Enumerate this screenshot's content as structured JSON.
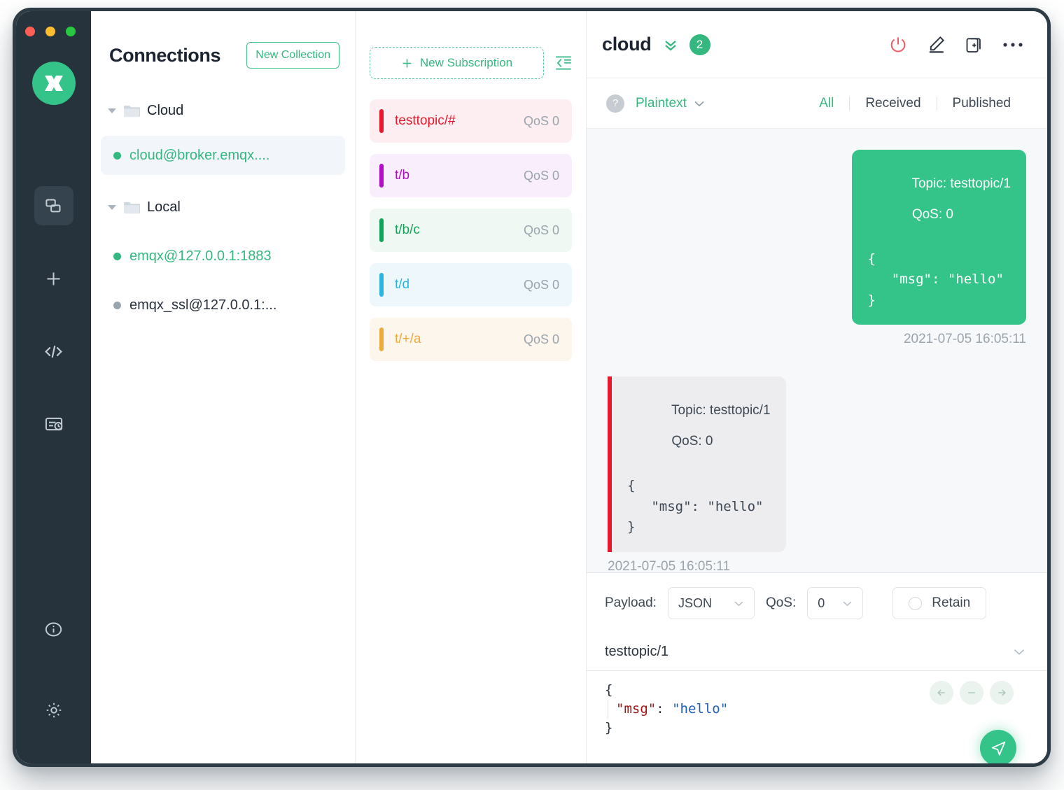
{
  "window": {
    "traffic_lights": [
      "close",
      "minimize",
      "maximize"
    ],
    "accent": "#34b87f",
    "logo_name": "mqttx-logo"
  },
  "rail": {
    "items": [
      {
        "icon": "connections-icon",
        "name": "rail-connections",
        "active": true
      },
      {
        "icon": "plus-icon",
        "name": "rail-new-connection",
        "active": false
      },
      {
        "icon": "code-icon",
        "name": "rail-script",
        "active": false
      },
      {
        "icon": "log-history-icon",
        "name": "rail-log",
        "active": false
      }
    ],
    "bottom_items": [
      {
        "icon": "info-icon",
        "name": "rail-about",
        "active": false
      },
      {
        "icon": "gear-icon",
        "name": "rail-settings",
        "active": false
      }
    ]
  },
  "connections": {
    "title": "Connections",
    "new_collection_label": "New Collection",
    "groups": [
      {
        "label": "Cloud",
        "items": [
          {
            "label": "cloud@broker.emqx....",
            "status": "online",
            "selected": true
          }
        ]
      },
      {
        "label": "Local",
        "items": [
          {
            "label": "emqx@127.0.0.1:1883",
            "status": "online",
            "selected": false
          },
          {
            "label": "emqx_ssl@127.0.0.1:...",
            "status": "offline",
            "selected": false
          }
        ]
      }
    ]
  },
  "subscriptions": {
    "new_subscription_label": "New Subscription",
    "collapse_icon": "collapse-left-icon",
    "items": [
      {
        "topic": "testtopic/#",
        "qos": "QoS 0",
        "color": "#e8182c",
        "bg": "#fdeff1"
      },
      {
        "topic": "t/b",
        "qos": "QoS 0",
        "color": "#b10fc6",
        "bg": "#f9effc"
      },
      {
        "topic": "t/b/c",
        "qos": "QoS 0",
        "color": "#14a35a",
        "bg": "#eff8f2"
      },
      {
        "topic": "t/d",
        "qos": "QoS 0",
        "color": "#2cb5e0",
        "bg": "#eef8fc"
      },
      {
        "topic": "t/+/a",
        "qos": "QoS 0",
        "color": "#edab3d",
        "bg": "#fdf6ec"
      }
    ]
  },
  "header": {
    "connection_name": "cloud",
    "chevrons_icon": "double-chevron-down-icon",
    "badge_count": "2",
    "actions": [
      {
        "name": "disconnect-button",
        "icon": "power-icon"
      },
      {
        "name": "edit-connection-button",
        "icon": "pencil-icon"
      },
      {
        "name": "new-window-button",
        "icon": "new-window-plus-icon"
      },
      {
        "name": "more-button",
        "icon": "ellipsis-icon"
      }
    ]
  },
  "filter_bar": {
    "help_icon": "question-mark-icon",
    "format": "Plaintext",
    "format_chevron": "chevron-down-icon",
    "tabs": [
      {
        "label": "All",
        "active": true
      },
      {
        "label": "Received",
        "active": false
      },
      {
        "label": "Published",
        "active": false
      }
    ]
  },
  "messages": [
    {
      "direction": "out",
      "topic_label": "Topic: testtopic/1",
      "qos_label": "QoS: 0",
      "payload": "{\n   \"msg\": \"hello\"\n}",
      "time": "2021-07-05 16:05:11"
    },
    {
      "direction": "in",
      "topic_label": "Topic: testtopic/1",
      "qos_label": "QoS: 0",
      "payload": "{\n   \"msg\": \"hello\"\n}",
      "time": "2021-07-05 16:05:11",
      "accent": "#e8182c"
    }
  ],
  "composer": {
    "payload_label": "Payload:",
    "payload_value": "JSON",
    "qos_label": "QoS:",
    "qos_value": "0",
    "retain_label": "Retain",
    "retain_checked": false,
    "topic_value": "testtopic/1",
    "topic_chevron": "chevron-down-icon",
    "editor": {
      "line1": "{",
      "key": "\"msg\"",
      "colon": ": ",
      "value": "\"hello\"",
      "line3": "}"
    },
    "nav_buttons": [
      {
        "name": "editor-back-button",
        "icon": "arrow-left-icon"
      },
      {
        "name": "editor-collapse-button",
        "icon": "minus-icon"
      },
      {
        "name": "editor-forward-button",
        "icon": "arrow-right-icon"
      }
    ],
    "send_icon": "send-paper-plane-icon"
  }
}
